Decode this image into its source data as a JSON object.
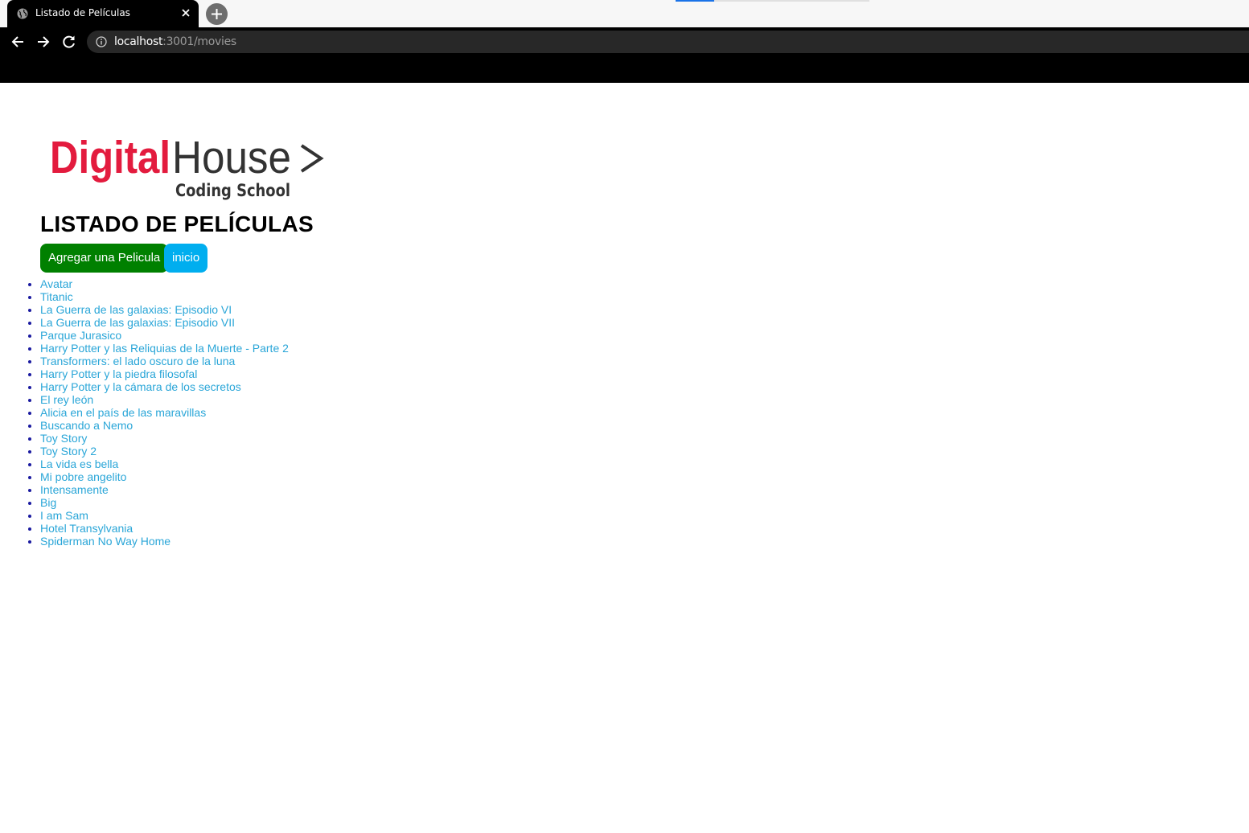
{
  "browser": {
    "tab_title": "Listado de Películas",
    "url_host": "localhost",
    "url_path": ":3001/movies"
  },
  "logo": {
    "brand_red": "Digital",
    "brand_dark": "House",
    "subtitle": "Coding School",
    "colors": {
      "red": "#e31b3e",
      "dark": "#333333"
    }
  },
  "page": {
    "title": "LISTADO DE PELÍCULAS",
    "add_button": "Agregar una Pelicula",
    "home_button": "inicio"
  },
  "movies": [
    "Avatar",
    "Titanic",
    "La Guerra de las galaxias: Episodio VI",
    "La Guerra de las galaxias: Episodio VII",
    "Parque Jurasico",
    "Harry Potter y las Reliquias de la Muerte - Parte 2",
    "Transformers: el lado oscuro de la luna",
    "Harry Potter y la piedra filosofal",
    "Harry Potter y la cámara de los secretos",
    "El rey león",
    "Alicia en el país de las maravillas",
    "Buscando a Nemo",
    "Toy Story",
    "Toy Story 2",
    "La vida es bella",
    "Mi pobre angelito",
    "Intensamente",
    "Big",
    "I am Sam",
    "Hotel Transylvania",
    "Spiderman No Way Home"
  ],
  "colors": {
    "add_button": "#008000",
    "home_button": "#00aeef",
    "link": "#2aa6d8"
  }
}
